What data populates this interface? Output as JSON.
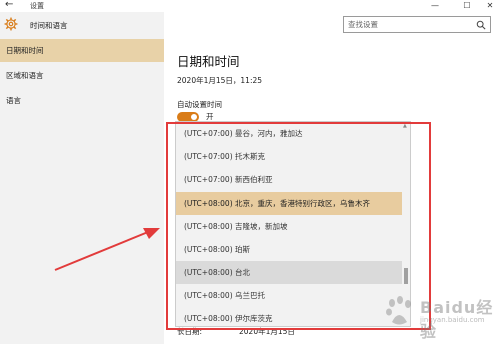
{
  "window": {
    "back_icon": "arrow-left-icon",
    "title": "设置",
    "controls": [
      "—",
      "☐",
      "✕"
    ]
  },
  "sidebar": {
    "header_label": "时间和语言",
    "header_icon": "gear-icon",
    "items": [
      {
        "label": "日期和时间",
        "active": true
      },
      {
        "label": "区域和语言",
        "active": false
      },
      {
        "label": "语言",
        "active": false
      }
    ]
  },
  "search": {
    "placeholder": "查找设置",
    "icon": "search-icon"
  },
  "main": {
    "title": "日期和时间",
    "datetime": "2020年1月15日，11:25",
    "auto_time_label": "自动设置时间",
    "toggle_state_label": "开",
    "toggle_on": true,
    "bottom_label": "长日期:",
    "bottom_value": "2020年1月15日"
  },
  "timezone_list": {
    "items": [
      {
        "label": "(UTC+07:00) 曼谷，河内，雅加达",
        "state": "normal"
      },
      {
        "label": "(UTC+07:00) 托木斯克",
        "state": "normal"
      },
      {
        "label": "(UTC+07:00) 新西伯利亚",
        "state": "normal"
      },
      {
        "label": "(UTC+08:00) 北京，重庆，香港特别行政区，乌鲁木齐",
        "state": "selected"
      },
      {
        "label": "(UTC+08:00) 吉隆坡，新加坡",
        "state": "normal"
      },
      {
        "label": "(UTC+08:00) 珀斯",
        "state": "normal"
      },
      {
        "label": "(UTC+08:00) 台北",
        "state": "hover"
      },
      {
        "label": "(UTC+08:00) 乌兰巴托",
        "state": "normal"
      },
      {
        "label": "(UTC+08:00) 伊尔库茨克",
        "state": "normal"
      }
    ]
  },
  "annotation": {
    "box_color": "#e23b3b",
    "arrow_color": "#e23b3b"
  },
  "watermark": {
    "text": "Baidu经验",
    "url": "jingyan.baidu.com"
  },
  "colors": {
    "accent": "#d97c18",
    "selected_bg": "#e8cc9f",
    "sidebar_active_bg": "#e8d2a8",
    "sidebar_bg": "#f2f2f2"
  }
}
